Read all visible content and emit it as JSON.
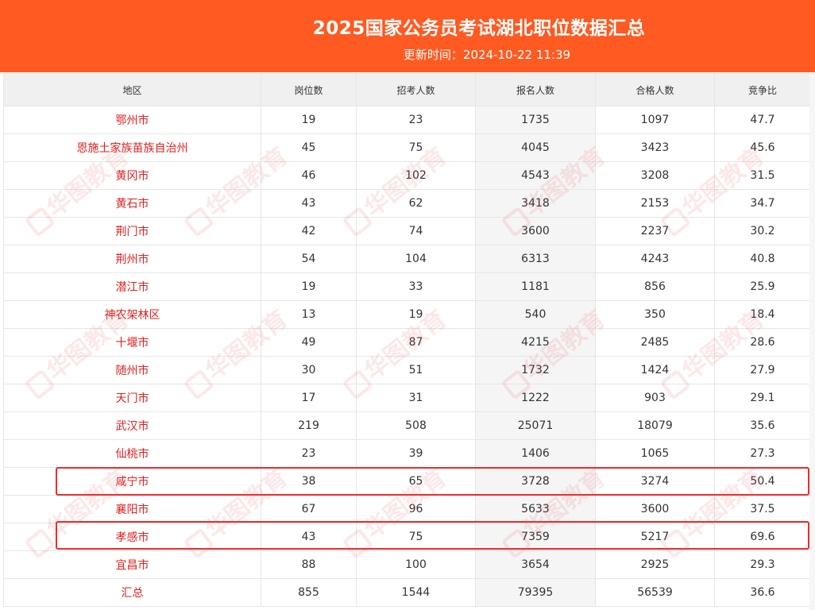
{
  "header": {
    "title": "2025国家公务员考试湖北职位数据汇总",
    "update_label": "更新时间：2024-10-22 11:39"
  },
  "table": {
    "columns": [
      "地区",
      "岗位数",
      "招考人数",
      "报名人数",
      "合格人数",
      "竞争比"
    ],
    "rows": [
      [
        "鄂州市",
        "19",
        "23",
        "1735",
        "1097",
        "47.7"
      ],
      [
        "恩施土家族苗族自治州",
        "45",
        "75",
        "4045",
        "3423",
        "45.6"
      ],
      [
        "黄冈市",
        "46",
        "102",
        "4543",
        "3208",
        "31.5"
      ],
      [
        "黄石市",
        "43",
        "62",
        "3418",
        "2153",
        "34.7"
      ],
      [
        "荆门市",
        "42",
        "74",
        "3600",
        "2237",
        "30.2"
      ],
      [
        "荆州市",
        "54",
        "104",
        "6313",
        "4243",
        "40.8"
      ],
      [
        "潜江市",
        "19",
        "33",
        "1181",
        "856",
        "25.9"
      ],
      [
        "神农架林区",
        "13",
        "19",
        "540",
        "350",
        "18.4"
      ],
      [
        "十堰市",
        "49",
        "87",
        "4215",
        "2485",
        "28.6"
      ],
      [
        "随州市",
        "30",
        "51",
        "1732",
        "1424",
        "27.9"
      ],
      [
        "天门市",
        "17",
        "31",
        "1222",
        "903",
        "29.1"
      ],
      [
        "武汉市",
        "219",
        "508",
        "25071",
        "18079",
        "35.6"
      ],
      [
        "仙桃市",
        "23",
        "39",
        "1406",
        "1065",
        "27.3"
      ],
      [
        "咸宁市",
        "38",
        "65",
        "3728",
        "3274",
        "50.4"
      ],
      [
        "襄阳市",
        "67",
        "96",
        "5633",
        "3600",
        "37.5"
      ],
      [
        "孝感市",
        "43",
        "75",
        "7359",
        "5217",
        "69.6"
      ],
      [
        "宜昌市",
        "88",
        "100",
        "3654",
        "2925",
        "29.3"
      ],
      [
        "汇总",
        "855",
        "1544",
        "79395",
        "56539",
        "36.6"
      ]
    ],
    "highlighted_rows": [
      "咸宁市",
      "孝感市"
    ]
  },
  "watermark": {
    "text": "华图教育"
  },
  "colors": {
    "header_bg": "#fe5a22",
    "region_text": "#e0201f",
    "highlight_border": "#ef2a2a",
    "header_row_bg": "#f0f0f0"
  }
}
